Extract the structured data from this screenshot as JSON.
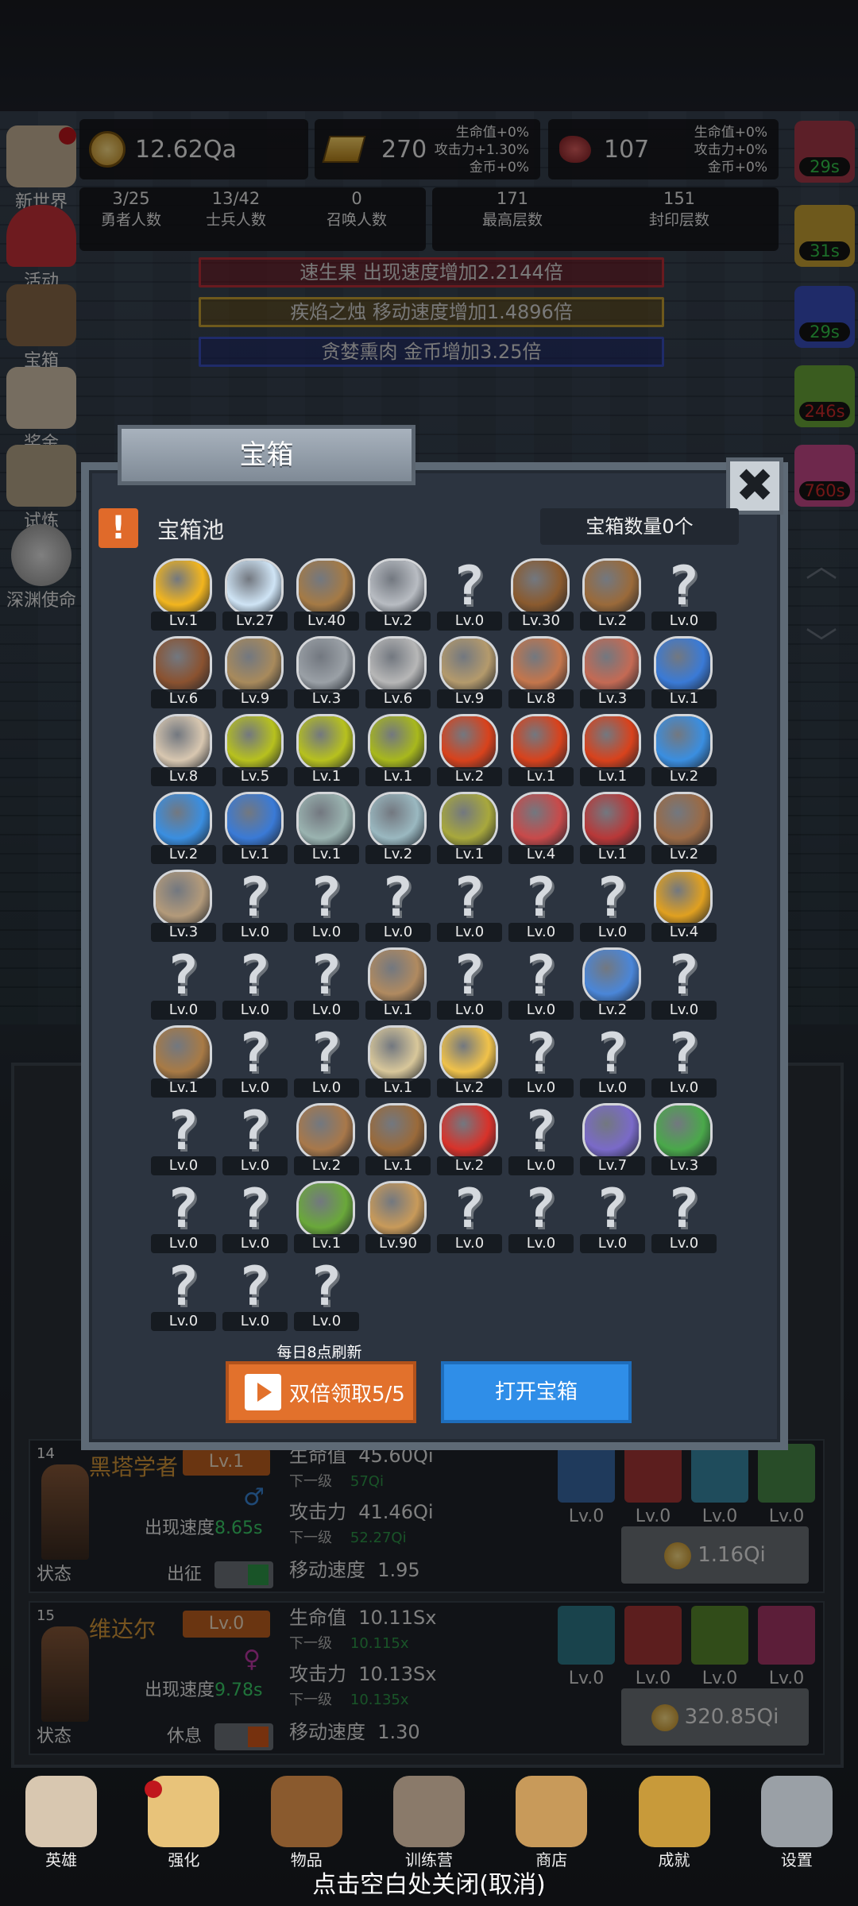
{
  "resources": {
    "gold": "12.62Qa",
    "bars": "270",
    "meat": "107",
    "bars_bonus": [
      "生命值+0%",
      "攻击力+1.30%",
      "金币+0%"
    ],
    "meat_bonus": [
      "生命值+0%",
      "攻击力+0%",
      "金币+0%"
    ]
  },
  "counters": [
    {
      "value": "3/25",
      "label": "勇者人数"
    },
    {
      "value": "13/42",
      "label": "士兵人数"
    },
    {
      "value": "0",
      "label": "召唤人数"
    },
    {
      "value": "171",
      "label": "最高层数"
    },
    {
      "value": "151",
      "label": "封印层数"
    }
  ],
  "buffs": [
    {
      "text": "速生果 出现速度增加2.2144倍",
      "color": "#c0303a"
    },
    {
      "text": "疾焰之烛 移动速度增加1.4896倍",
      "color": "#c9a233"
    },
    {
      "text": "贪婪熏肉 金币增加3.25倍",
      "color": "#3a4fbf"
    }
  ],
  "left_menu": [
    {
      "label": "新世界",
      "icon": "castle-icon"
    },
    {
      "label": "活动",
      "icon": "heart-icon"
    },
    {
      "label": "宝箱",
      "icon": "chest-icon"
    },
    {
      "label": "奖金",
      "icon": "envelope-icon"
    },
    {
      "label": "试炼",
      "icon": "scroll-icon"
    },
    {
      "label": "深渊使命",
      "icon": "orb-icon"
    }
  ],
  "right_timers": [
    {
      "text": "29s",
      "color": "#34c84b"
    },
    {
      "text": "31s",
      "color": "#34c84b"
    },
    {
      "text": "29s",
      "color": "#34c84b"
    },
    {
      "text": "246s",
      "color": "#d12a2a"
    },
    {
      "text": "760s",
      "color": "#d12a2a"
    }
  ],
  "modal": {
    "title": "宝箱",
    "close": "✖",
    "pool_icon": "!",
    "pool_title": "宝箱池",
    "pool_count": "宝箱数量0个",
    "refresh_note": "每日8点刷新",
    "double_button": "双倍领取5/5",
    "open_button": "打开宝箱"
  },
  "items": [
    {
      "icon": "crown-icon",
      "lvl": "Lv.1",
      "color": "#f2b51e"
    },
    {
      "icon": "diamond-icon",
      "lvl": "Lv.27",
      "color": "#cfe4f5"
    },
    {
      "icon": "sword-icon",
      "lvl": "Lv.40",
      "color": "#a57a45"
    },
    {
      "icon": "sword-icon",
      "lvl": "Lv.2",
      "color": "#b8bcc2"
    },
    {
      "icon": "unknown-icon",
      "lvl": "Lv.0"
    },
    {
      "icon": "armor-icon",
      "lvl": "Lv.30",
      "color": "#8a5a2e"
    },
    {
      "icon": "backpack-icon",
      "lvl": "Lv.2",
      "color": "#9a6a3a"
    },
    {
      "icon": "unknown-icon",
      "lvl": "Lv.0"
    },
    {
      "icon": "helmet-icon",
      "lvl": "Lv.6",
      "color": "#8a5230"
    },
    {
      "icon": "dagger-icon",
      "lvl": "Lv.9",
      "color": "#a88a5c"
    },
    {
      "icon": "helmet-icon",
      "lvl": "Lv.3",
      "color": "#9aa0a6"
    },
    {
      "icon": "hammer-icon",
      "lvl": "Lv.6",
      "color": "#b7b7b7"
    },
    {
      "icon": "helmet-icon",
      "lvl": "Lv.9",
      "color": "#b49a6c"
    },
    {
      "icon": "meat-icon",
      "lvl": "Lv.8",
      "color": "#c4764c"
    },
    {
      "icon": "steak-icon",
      "lvl": "Lv.3",
      "color": "#c46a54"
    },
    {
      "icon": "pouch-icon",
      "lvl": "Lv.1",
      "color": "#3a7ad6"
    },
    {
      "icon": "bread-icon",
      "lvl": "Lv.8",
      "color": "#d8c7b0"
    },
    {
      "icon": "potion-icon",
      "lvl": "Lv.5",
      "color": "#b7c11e"
    },
    {
      "icon": "potion-icon",
      "lvl": "Lv.1",
      "color": "#b7c11e"
    },
    {
      "icon": "potion-icon",
      "lvl": "Lv.1",
      "color": "#a8b81c"
    },
    {
      "icon": "potion-icon",
      "lvl": "Lv.2",
      "color": "#d8421c"
    },
    {
      "icon": "potion-icon",
      "lvl": "Lv.1",
      "color": "#d8421c"
    },
    {
      "icon": "potion-icon",
      "lvl": "Lv.1",
      "color": "#d8421c"
    },
    {
      "icon": "potion-icon",
      "lvl": "Lv.2",
      "color": "#3a8ee0"
    },
    {
      "icon": "potion-icon",
      "lvl": "Lv.2",
      "color": "#3a8ee0"
    },
    {
      "icon": "potion-icon",
      "lvl": "Lv.1",
      "color": "#3a7ad6"
    },
    {
      "icon": "bottle-icon",
      "lvl": "Lv.1",
      "color": "#9ab3b0"
    },
    {
      "icon": "bottle-icon",
      "lvl": "Lv.2",
      "color": "#9ab8c0"
    },
    {
      "icon": "bottle-icon",
      "lvl": "Lv.1",
      "color": "#a8a83c"
    },
    {
      "icon": "bottle-icon",
      "lvl": "Lv.4",
      "color": "#c84a4a"
    },
    {
      "icon": "winged-boot-icon",
      "lvl": "Lv.1",
      "color": "#b83838"
    },
    {
      "icon": "boot-icon",
      "lvl": "Lv.2",
      "color": "#9a6a45"
    },
    {
      "icon": "boot-icon",
      "lvl": "Lv.3",
      "color": "#b39a7a"
    },
    {
      "icon": "unknown-icon",
      "lvl": "Lv.0"
    },
    {
      "icon": "unknown-icon",
      "lvl": "Lv.0"
    },
    {
      "icon": "unknown-icon",
      "lvl": "Lv.0"
    },
    {
      "icon": "unknown-icon",
      "lvl": "Lv.0"
    },
    {
      "icon": "unknown-icon",
      "lvl": "Lv.0"
    },
    {
      "icon": "unknown-icon",
      "lvl": "Lv.0"
    },
    {
      "icon": "torch-icon",
      "lvl": "Lv.4",
      "color": "#e0a020"
    },
    {
      "icon": "unknown-icon",
      "lvl": "Lv.0"
    },
    {
      "icon": "unknown-icon",
      "lvl": "Lv.0"
    },
    {
      "icon": "unknown-icon",
      "lvl": "Lv.0"
    },
    {
      "icon": "staff-icon",
      "lvl": "Lv.1",
      "color": "#b08a60"
    },
    {
      "icon": "unknown-icon",
      "lvl": "Lv.0"
    },
    {
      "icon": "unknown-icon",
      "lvl": "Lv.0"
    },
    {
      "icon": "wand-icon",
      "lvl": "Lv.2",
      "color": "#4a86d8"
    },
    {
      "icon": "unknown-icon",
      "lvl": "Lv.0"
    },
    {
      "icon": "backpack-icon",
      "lvl": "Lv.1",
      "color": "#a87a45"
    },
    {
      "icon": "unknown-icon",
      "lvl": "Lv.0"
    },
    {
      "icon": "unknown-icon",
      "lvl": "Lv.0"
    },
    {
      "icon": "bone-club-icon",
      "lvl": "Lv.1",
      "color": "#d8c79a"
    },
    {
      "icon": "cheese-icon",
      "lvl": "Lv.2",
      "color": "#f0c24a"
    },
    {
      "icon": "unknown-icon",
      "lvl": "Lv.0"
    },
    {
      "icon": "unknown-icon",
      "lvl": "Lv.0"
    },
    {
      "icon": "unknown-icon",
      "lvl": "Lv.0"
    },
    {
      "icon": "unknown-icon",
      "lvl": "Lv.0"
    },
    {
      "icon": "unknown-icon",
      "lvl": "Lv.0"
    },
    {
      "icon": "bow-icon",
      "lvl": "Lv.2",
      "color": "#a8784a"
    },
    {
      "icon": "quiver-icon",
      "lvl": "Lv.1",
      "color": "#9a6a3a"
    },
    {
      "icon": "flower-icon",
      "lvl": "Lv.2",
      "color": "#d8322a"
    },
    {
      "icon": "unknown-icon",
      "lvl": "Lv.0"
    },
    {
      "icon": "monster-icon",
      "lvl": "Lv.7",
      "color": "#7a6ac8"
    },
    {
      "icon": "amulet-icon",
      "lvl": "Lv.3",
      "color": "#4aa84a"
    },
    {
      "icon": "unknown-icon",
      "lvl": "Lv.0"
    },
    {
      "icon": "unknown-icon",
      "lvl": "Lv.0"
    },
    {
      "icon": "scepter-icon",
      "lvl": "Lv.1",
      "color": "#6aa83a"
    },
    {
      "icon": "mug-icon",
      "lvl": "Lv.90",
      "color": "#c89a5a"
    },
    {
      "icon": "unknown-icon",
      "lvl": "Lv.0"
    },
    {
      "icon": "unknown-icon",
      "lvl": "Lv.0"
    },
    {
      "icon": "unknown-icon",
      "lvl": "Lv.0"
    },
    {
      "icon": "unknown-icon",
      "lvl": "Lv.0"
    },
    {
      "icon": "unknown-icon",
      "lvl": "Lv.0"
    },
    {
      "icon": "unknown-icon",
      "lvl": "Lv.0"
    },
    {
      "icon": "unknown-icon",
      "lvl": "Lv.0"
    }
  ],
  "heroes": [
    {
      "index": "14",
      "name": "黑塔学者",
      "level": "Lv.1",
      "gender": "♂",
      "gender_color": "#3a86d8",
      "speed_label": "出现速度",
      "speed": "8.65s",
      "status_label": "状态",
      "mode": "出征",
      "toggle_color": "#2e9a4a",
      "hp_label": "生命值",
      "hp": "45.60Qi",
      "next_label": "下一级",
      "hp_next": "57Qi",
      "atk_label": "攻击力",
      "atk": "41.46Qi",
      "atk_next": "52.27Qi",
      "move_label": "移动速度",
      "move": "1.95",
      "skills": [
        "Lv.0",
        "Lv.0",
        "Lv.0",
        "Lv.0"
      ],
      "skill_icons": [
        "shield-icon",
        "sword-icon",
        "wing-icon",
        "helmet-icon"
      ],
      "skill_colors": [
        "#3a6aa8",
        "#a83838",
        "#3a8aa8",
        "#4a8a4a"
      ],
      "cost": "1.16Qi"
    },
    {
      "index": "15",
      "name": "维达尔",
      "level": "Lv.0",
      "gender": "♀",
      "gender_color": "#c03aa8",
      "speed_label": "出现速度",
      "speed": "9.78s",
      "status_label": "状态",
      "mode": "休息",
      "toggle_color": "#d85a1a",
      "hp_label": "生命值",
      "hp": "10.11Sx",
      "next_label": "下一级",
      "hp_next": "10.115x",
      "atk_label": "攻击力",
      "atk": "10.13Sx",
      "atk_next": "10.135x",
      "move_label": "移动速度",
      "move": "1.30",
      "skills": [
        "Lv.0",
        "Lv.0",
        "Lv.0",
        "Lv.0"
      ],
      "skill_icons": [
        "shield-icon",
        "sword-icon",
        "staff-icon",
        "boot-icon"
      ],
      "skill_colors": [
        "#2e7a8a",
        "#a83838",
        "#5a8a2e",
        "#a83868"
      ],
      "cost": "320.85Qi"
    }
  ],
  "nav": [
    {
      "label": "英雄",
      "icon": "skull-icon"
    },
    {
      "label": "强化",
      "icon": "candle-icon",
      "badge": true
    },
    {
      "label": "物品",
      "icon": "book-icon"
    },
    {
      "label": "训练营",
      "icon": "lantern-icon"
    },
    {
      "label": "商店",
      "icon": "mug-icon"
    },
    {
      "label": "成就",
      "icon": "key-icon"
    },
    {
      "label": "设置",
      "icon": "gear-icon"
    }
  ],
  "close_hint": "点击空白处关闭(取消)"
}
